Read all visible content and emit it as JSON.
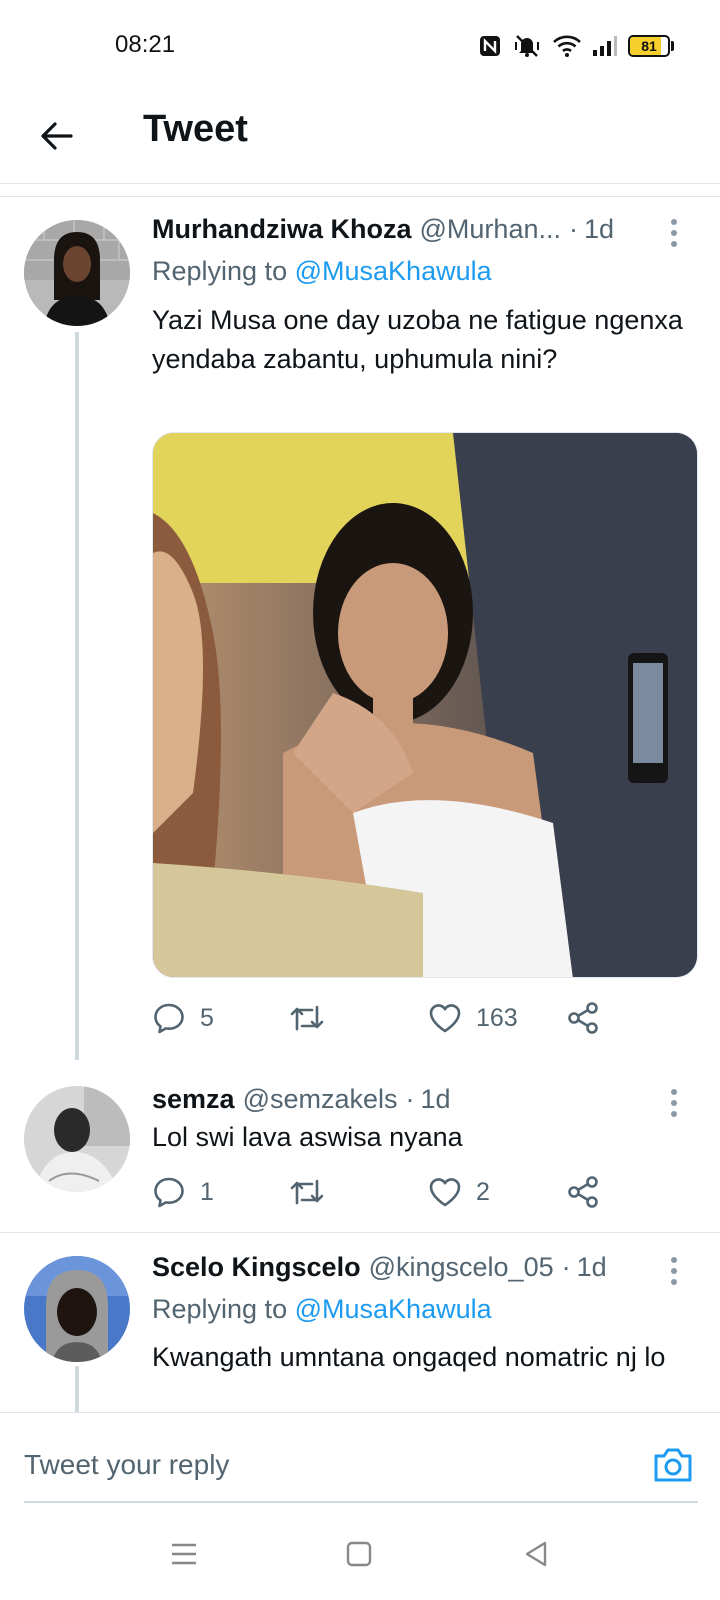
{
  "status_bar": {
    "time": "08:21",
    "battery_level": "81",
    "battery_fraction": 0.81,
    "icons": [
      "nfc-icon",
      "mute-vibrate-icon",
      "wifi-icon",
      "signal-icon",
      "battery-icon"
    ]
  },
  "header": {
    "title": "Tweet",
    "back_icon": "back-arrow-icon"
  },
  "tweets": [
    {
      "display_name": "Murhandziwa Khoza",
      "handle": "@Murhan...",
      "separator": "·",
      "time": "1d",
      "replying_prefix": "Replying to",
      "replying_to": "@MusaKhawula",
      "text": "Yazi Musa one day uzoba ne fatigue ngenxa yendaba zabantu, uphumula nini?",
      "has_media": true,
      "replies": "5",
      "retweets": "",
      "likes": "163"
    },
    {
      "display_name": "semza",
      "handle": "@semzakels",
      "separator": "·",
      "time": "1d",
      "text": "Lol swi lava aswisa nyana",
      "replies": "1",
      "retweets": "",
      "likes": "2"
    },
    {
      "display_name": "Scelo Kingscelo",
      "handle": "@kingscelo_05",
      "separator": "·",
      "time": "1d",
      "replying_prefix": "Replying to",
      "replying_to": "@MusaKhawula",
      "text": "Kwangath umntana ongaqed nomatric nj lo"
    }
  ],
  "reply_bar": {
    "placeholder": "Tweet your reply",
    "camera_icon": "camera-icon"
  },
  "nav_bar": {
    "icons": [
      "menu-icon",
      "home-square-icon",
      "back-triangle-icon"
    ]
  },
  "colors": {
    "accent": "#1d9bf0",
    "text": "#0f1419",
    "secondary": "#536471",
    "thread_line": "#cfd9de",
    "battery": "#f5cf2b"
  }
}
